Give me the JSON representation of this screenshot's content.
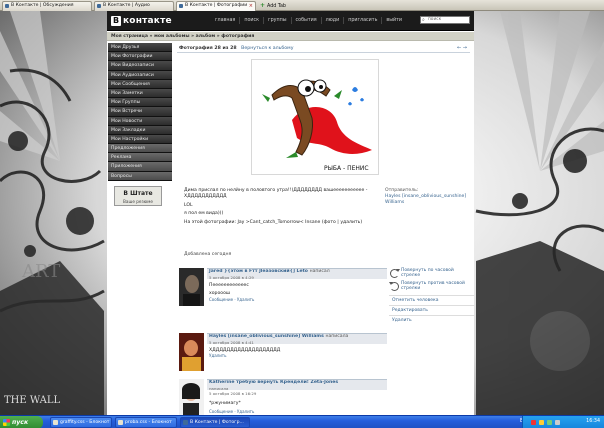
{
  "browser": {
    "tabs": [
      {
        "label": "В Контакте | Обсуждения",
        "active": false
      },
      {
        "label": "В Контакте | Аудио",
        "active": false
      },
      {
        "label": "В Контакте | Фотографии",
        "active": true
      }
    ],
    "new_tab_label": "Add Tab"
  },
  "site": {
    "logo_letter": "В",
    "logo_text": "контакте",
    "nav": [
      "главная",
      "поиск",
      "группы",
      "события",
      "люди",
      "пригласить",
      "выйти"
    ],
    "search_placeholder": "поиск",
    "breadcrumb": "Моя страница » мои альбомы » альбом » фотография"
  },
  "left_menu": {
    "items": [
      "Мои Друзья",
      "Мои Фотографии",
      "Мои Видеозаписи",
      "Мои Аудиозаписи",
      "Мои Сообщения",
      "Мои Заметки",
      "Мои Группы",
      "Мои Встречи",
      "Мои Новости",
      "Мои Закладки",
      "Мои Настройки",
      "Предложения",
      "Реклама",
      "Приложения",
      "Вопросы"
    ],
    "status_title": "В Штате",
    "status_subtitle": "Ваше резюме"
  },
  "photo_page": {
    "counter": "Фотография 28 из 28",
    "back_link": "Вернуться к альбому",
    "nav_arrows": "← →",
    "caption_art": "РЫБА - ПЕНИС",
    "description_lines": [
      "Дима прислал по нелйну в половтого утра!!)ДДДДДДДД вашеееееееееее - ХДДДДДДДДДДД",
      "LOL",
      "я пол ем вида)))",
      "На этой фотографии: Jay >Cant_catch_Tomorrow< Insane (фото | удалить)"
    ],
    "added": "Добавлена сегодня",
    "sender_label": "Отправитель:",
    "sender_name": "Hayles [insane_oblivious_sunshine] Williams"
  },
  "comments": [
    {
      "author": "Jared }{этом в Fтт Jleaзовский{] Leto",
      "wrote": "написал",
      "date": "5 октября 2008 в 4:29",
      "text": "Пеееееееееееес",
      "text2": "хорооош",
      "actions": "Сообщение · Удалить"
    },
    {
      "author": "Hayles [insane_oblivious_sunshine] Williams",
      "wrote": "написала",
      "date": "5 октября 2008 в 4:41",
      "text": "ХДДДДДДДДДДДДДДДДДДД",
      "actions": "Удалить"
    },
    {
      "author": "Katherine требую вернуть Крендели! Zeta-Jones",
      "wrote": "написала",
      "date": "5 октября 2008 в 16:29",
      "text": "*ржунимагу*",
      "actions": "Сообщение · Удалить"
    }
  ],
  "right_actions": {
    "rotate_cw": "Повернуть по часовой стрелке",
    "rotate_ccw": "Повернуть против часовой стрелки",
    "links": [
      "Отметить человека",
      "Редактировать",
      "Удалить"
    ]
  },
  "background_text": [
    "ART",
    "THE WALL"
  ],
  "taskbar": {
    "start": "пуск",
    "tasks": [
      {
        "label": "graffity.css - Блокнот",
        "active": false
      },
      {
        "label": "proba.css - Блокнот",
        "active": false
      },
      {
        "label": "В Контакте | Фотогр...",
        "active": true
      }
    ],
    "lang": "EN",
    "clock": "16:34"
  }
}
